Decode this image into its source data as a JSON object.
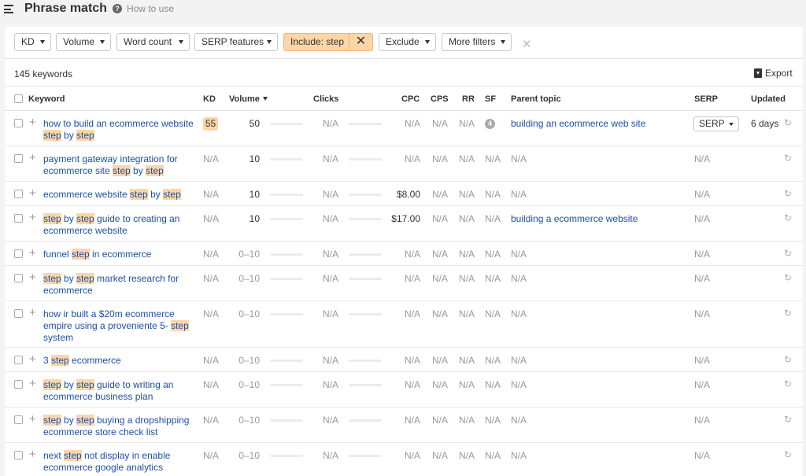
{
  "header": {
    "title": "Phrase match",
    "help": "How to use"
  },
  "filters": {
    "kd": "KD",
    "volume": "Volume",
    "word_count": "Word count",
    "serp_features": "SERP features",
    "include": "Include: step",
    "exclude": "Exclude",
    "more": "More filters"
  },
  "summary": {
    "count": "145 keywords",
    "export": "Export"
  },
  "columns": {
    "keyword": "Keyword",
    "kd": "KD",
    "volume": "Volume",
    "clicks": "Clicks",
    "cpc": "CPC",
    "cps": "CPS",
    "rr": "RR",
    "sf": "SF",
    "parent": "Parent topic",
    "serp": "SERP",
    "updated": "Updated"
  },
  "rows": [
    {
      "parts": [
        [
          "how to build an ecommerce website ",
          false
        ],
        [
          "step",
          true
        ],
        [
          " by ",
          false
        ],
        [
          "step",
          true
        ]
      ],
      "kd": "55",
      "volume": "50",
      "clicks": "N/A",
      "cpc": "N/A",
      "cps": "N/A",
      "rr": "N/A",
      "sf": "4",
      "parent": "building an ecommerce web site",
      "serp": "SERP",
      "updated": "6 days"
    },
    {
      "parts": [
        [
          "payment gateway integration for ecommerce site ",
          false
        ],
        [
          "step",
          true
        ],
        [
          " by ",
          false
        ],
        [
          "step",
          true
        ]
      ],
      "kd": "N/A",
      "volume": "10",
      "clicks": "N/A",
      "cpc": "N/A",
      "cps": "N/A",
      "rr": "N/A",
      "sf": "N/A",
      "parent": "N/A",
      "serp": "N/A",
      "updated": ""
    },
    {
      "parts": [
        [
          "ecommerce website ",
          false
        ],
        [
          "step",
          true
        ],
        [
          " by ",
          false
        ],
        [
          "step",
          true
        ]
      ],
      "kd": "N/A",
      "volume": "10",
      "clicks": "N/A",
      "cpc": "$8.00",
      "cps": "N/A",
      "rr": "N/A",
      "sf": "N/A",
      "parent": "N/A",
      "serp": "N/A",
      "updated": ""
    },
    {
      "parts": [
        [
          "step",
          true
        ],
        [
          " by ",
          false
        ],
        [
          "step",
          true
        ],
        [
          " guide to creating an ecommerce website",
          false
        ]
      ],
      "kd": "N/A",
      "volume": "10",
      "clicks": "N/A",
      "cpc": "$17.00",
      "cps": "N/A",
      "rr": "N/A",
      "sf": "N/A",
      "parent": "building a ecommerce website",
      "serp": "N/A",
      "updated": ""
    },
    {
      "parts": [
        [
          "funnel ",
          false
        ],
        [
          "step",
          true
        ],
        [
          " in ecommerce",
          false
        ]
      ],
      "kd": "N/A",
      "volume": "0–10",
      "clicks": "N/A",
      "cpc": "N/A",
      "cps": "N/A",
      "rr": "N/A",
      "sf": "N/A",
      "parent": "N/A",
      "serp": "N/A",
      "updated": ""
    },
    {
      "parts": [
        [
          "step",
          true
        ],
        [
          " by ",
          false
        ],
        [
          "step",
          true
        ],
        [
          " market research for ecommerce",
          false
        ]
      ],
      "kd": "N/A",
      "volume": "0–10",
      "clicks": "N/A",
      "cpc": "N/A",
      "cps": "N/A",
      "rr": "N/A",
      "sf": "N/A",
      "parent": "N/A",
      "serp": "N/A",
      "updated": ""
    },
    {
      "parts": [
        [
          "how ir built a $20m ecommerce empire using a proveniente 5- ",
          false
        ],
        [
          "step",
          true
        ],
        [
          " system",
          false
        ]
      ],
      "kd": "N/A",
      "volume": "0–10",
      "clicks": "N/A",
      "cpc": "N/A",
      "cps": "N/A",
      "rr": "N/A",
      "sf": "N/A",
      "parent": "N/A",
      "serp": "N/A",
      "updated": ""
    },
    {
      "parts": [
        [
          "3 ",
          false
        ],
        [
          "step",
          true
        ],
        [
          " ecommerce",
          false
        ]
      ],
      "kd": "N/A",
      "volume": "0–10",
      "clicks": "N/A",
      "cpc": "N/A",
      "cps": "N/A",
      "rr": "N/A",
      "sf": "N/A",
      "parent": "N/A",
      "serp": "N/A",
      "updated": ""
    },
    {
      "parts": [
        [
          "step",
          true
        ],
        [
          " by ",
          false
        ],
        [
          "step",
          true
        ],
        [
          " guide to writing an ecommerce business plan",
          false
        ]
      ],
      "kd": "N/A",
      "volume": "0–10",
      "clicks": "N/A",
      "cpc": "N/A",
      "cps": "N/A",
      "rr": "N/A",
      "sf": "N/A",
      "parent": "N/A",
      "serp": "N/A",
      "updated": ""
    },
    {
      "parts": [
        [
          "step",
          true
        ],
        [
          " by ",
          false
        ],
        [
          "step",
          true
        ],
        [
          " buying a dropshipping ecommerce store check list",
          false
        ]
      ],
      "kd": "N/A",
      "volume": "0–10",
      "clicks": "N/A",
      "cpc": "N/A",
      "cps": "N/A",
      "rr": "N/A",
      "sf": "N/A",
      "parent": "N/A",
      "serp": "N/A",
      "updated": ""
    },
    {
      "parts": [
        [
          "next ",
          false
        ],
        [
          "step",
          true
        ],
        [
          " not display in enable ecommerce google analytics",
          false
        ]
      ],
      "kd": "N/A",
      "volume": "0–10",
      "clicks": "N/A",
      "cpc": "N/A",
      "cps": "N/A",
      "rr": "N/A",
      "sf": "N/A",
      "parent": "N/A",
      "serp": "N/A",
      "updated": ""
    }
  ]
}
